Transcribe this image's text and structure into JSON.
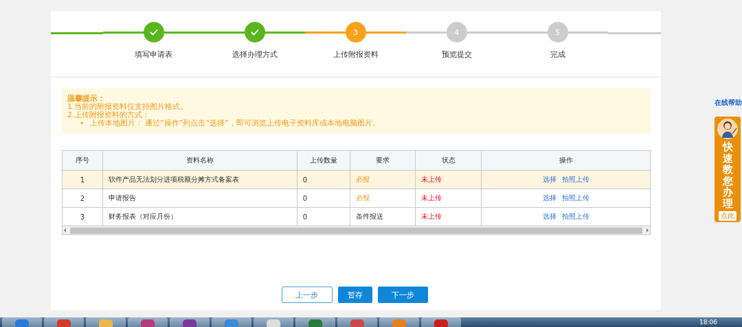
{
  "steps": [
    {
      "label": "填写申请表",
      "completed": true,
      "current": false
    },
    {
      "label": "选择办理方式",
      "completed": true,
      "current": false
    },
    {
      "number": "3",
      "label": "上传附报资料",
      "completed": false,
      "current": true
    },
    {
      "number": "4",
      "label": "预览提交",
      "completed": false,
      "current": false
    },
    {
      "number": "5",
      "label": "完成",
      "completed": false,
      "current": false
    }
  ],
  "notice": {
    "title": "温馨提示：",
    "lines": [
      "1.当前的附报资料仅支持图片格式。",
      "2.上传附报资料的方式："
    ],
    "bullets": [
      {
        "marker": "•",
        "text": "上传本地图片： 通过“操作”列点击“选择”，即可浏览上传电子资料库或本地电脑图片。"
      }
    ]
  },
  "table": {
    "columns": [
      "序号",
      "资料名称",
      "上传数量",
      "要求",
      "状态",
      "操作"
    ],
    "rows": [
      {
        "index": "1",
        "name": "软件产品无法划分进项税额分摊方式备案表",
        "count": "0",
        "requirement": "必报",
        "required": true,
        "status": "未上传",
        "actions": [
          "选择",
          "拍照上传"
        ],
        "selected": true
      },
      {
        "index": "2",
        "name": "申请报告",
        "count": "0",
        "requirement": "必报",
        "required": true,
        "status": "未上传",
        "actions": [
          "选择",
          "拍照上传"
        ],
        "selected": false
      },
      {
        "index": "3",
        "name": "财务报表（对应月份）",
        "count": "0",
        "requirement": "条件报送",
        "required": false,
        "status": "未上传",
        "actions": [
          "选择",
          "拍照上传"
        ],
        "selected": false
      }
    ]
  },
  "buttons": [
    {
      "label": "上一步",
      "kind": "outline"
    },
    {
      "label": "暂存",
      "kind": "primary"
    },
    {
      "label": "下一步",
      "kind": "primary"
    }
  ],
  "help": {
    "link": "在线帮助",
    "banner": "快速教您办理",
    "action": "点此"
  },
  "taskbar": {
    "clock": "18:06"
  }
}
